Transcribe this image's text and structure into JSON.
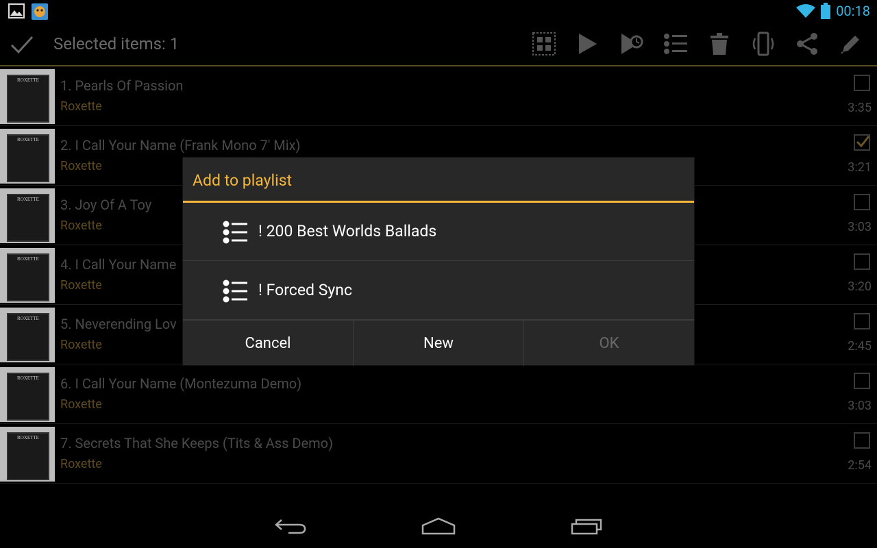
{
  "status_bar": {
    "time": "00:18",
    "icons": [
      "gallery-notification-icon",
      "app-notification-icon",
      "wifi-icon",
      "battery-icon"
    ]
  },
  "action_bar": {
    "title": "Selected items: 1",
    "actions": [
      "select-all-icon",
      "play-icon",
      "play-next-icon",
      "playlist-icon",
      "delete-icon",
      "ringtone-icon",
      "share-icon",
      "edit-icon"
    ]
  },
  "tracks": [
    {
      "title": "1. Pearls Of Passion",
      "artist": "Roxette",
      "duration": "3:35",
      "checked": false,
      "thumb_text": "ROXETTE"
    },
    {
      "title": "2. I Call Your Name  (Frank Mono 7' Mix)",
      "artist": "Roxette",
      "duration": "3:21",
      "checked": true,
      "thumb_text": "ROXETTE"
    },
    {
      "title": "3. Joy Of A Toy",
      "artist": "Roxette",
      "duration": "3:03",
      "checked": false,
      "thumb_text": "ROXETTE"
    },
    {
      "title": "4. I Call Your Name",
      "artist": "Roxette",
      "duration": "3:20",
      "checked": false,
      "thumb_text": "ROXETTE"
    },
    {
      "title": "5. Neverending Lov",
      "artist": "Roxette",
      "duration": "2:45",
      "checked": false,
      "thumb_text": "ROXETTE"
    },
    {
      "title": "6. I Call Your Name (Montezuma Demo)",
      "artist": "Roxette",
      "duration": "3:03",
      "checked": false,
      "thumb_text": "ROXETTE"
    },
    {
      "title": "7. Secrets That She Keeps (Tits & Ass Demo)",
      "artist": "Roxette",
      "duration": "2:54",
      "checked": false,
      "thumb_text": "ROXETTE"
    }
  ],
  "dialog": {
    "title": "Add to playlist",
    "playlists": [
      {
        "label": "! 200 Best Worlds Ballads"
      },
      {
        "label": "! Forced Sync"
      }
    ],
    "buttons": {
      "cancel": "Cancel",
      "new": "New",
      "ok": "OK"
    }
  },
  "colors": {
    "accent": "#f5b73a",
    "clock": "#33b5e5",
    "artist": "#5e4a1e"
  }
}
